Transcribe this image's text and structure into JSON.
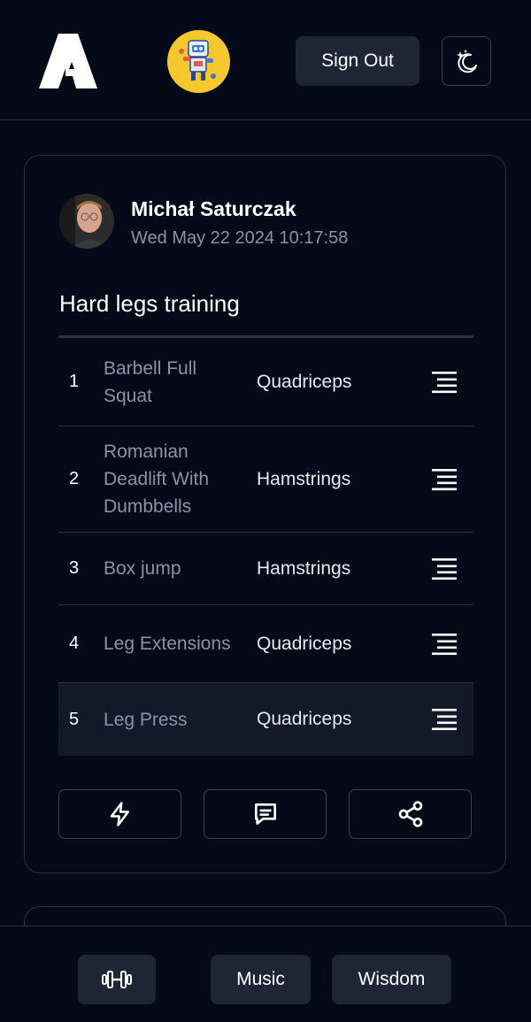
{
  "header": {
    "signout_label": "Sign Out",
    "logo_icon": "app-logo-icon",
    "avatar_icon": "robot-avatar-icon",
    "theme_icon": "moon-stars-icon"
  },
  "post": {
    "user_name": "Michał Saturczak",
    "date": "Wed May 22 2024 10:17:58",
    "title": "Hard legs training",
    "exercises": [
      {
        "num": "1",
        "name": "Barbell Full Squat",
        "muscle": "Quadriceps"
      },
      {
        "num": "2",
        "name": "Romanian Deadlift With Dumbbells",
        "muscle": "Hamstrings"
      },
      {
        "num": "3",
        "name": "Box jump",
        "muscle": "Hamstrings"
      },
      {
        "num": "4",
        "name": "Leg Extensions",
        "muscle": "Quadriceps"
      },
      {
        "num": "5",
        "name": "Leg Press",
        "muscle": "Quadriceps"
      }
    ],
    "actions": [
      "lightning-icon",
      "comment-icon",
      "share-icon"
    ]
  },
  "nav": {
    "workout_icon": "dumbbell-icon",
    "music_label": "Music",
    "wisdom_label": "Wisdom"
  },
  "colors": {
    "background": "#050a18",
    "button_bg": "#1e2636",
    "muted_text": "#8a93a6",
    "border": "#2a3142",
    "avatar_bg": "#f7c72e"
  }
}
